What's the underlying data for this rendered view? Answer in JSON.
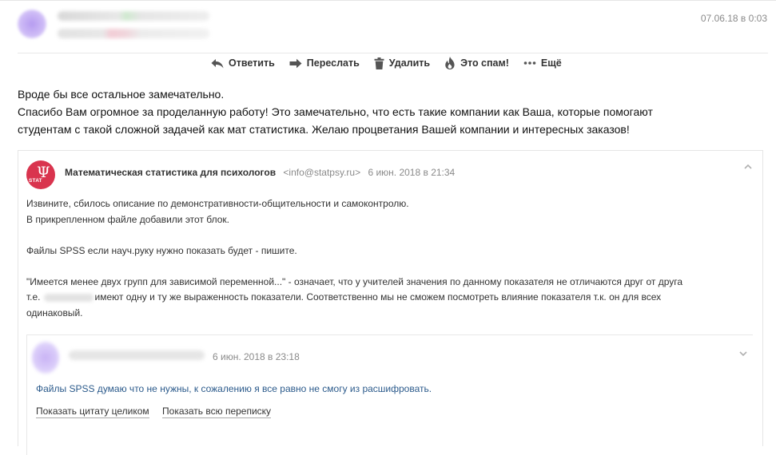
{
  "header": {
    "date": "07.06.18 в 0:03"
  },
  "toolbar": {
    "reply": "Ответить",
    "forward": "Переслать",
    "delete": "Удалить",
    "spam": "Это спам!",
    "more": "Ещё"
  },
  "message": {
    "lines": [
      "Вроде бы все остальное замечательно.",
      "Спасибо Вам огромное за проделанную работу! Это замечательно, что есть такие компании как Ваша, которые помогают",
      "студентам с такой сложной задачей как мат статистика. Желаю процветания Вашей компании и интересных заказов!"
    ]
  },
  "quoted": {
    "avatar_text": "STAT",
    "avatar_symbol": "Ψ",
    "sender": "Математическая статистика для психологов",
    "email": "<info@statpsy.ru>",
    "date": "6 июн. 2018 в 21:34",
    "lines": {
      "l1": "Извините, сбилось описание по демонстративности-общительности и самоконтролю.",
      "l2": "В прикрепленном файле добавили этот блок.",
      "l3": "Файлы SPSS если науч.руку нужно показать будет - пишите.",
      "l4": "\"Имеется менее двух групп для зависимой переменной...\" - означает, что у учителей значения по данному показателя не отличаются друг от друга",
      "l5a": "т.е.",
      "l5b": "имеют одну и ту же выраженность показатели. Соответственно мы не сможем посмотреть влияние показателя т.к. он для всех",
      "l6": "одинаковый."
    },
    "nested": {
      "date": "6 июн. 2018 в 23:18",
      "text": "Файлы SPSS думаю что не нужны, к сожалению я все равно не смогу из расшифровать.",
      "show_quote": "Показать цитату целиком",
      "show_thread": "Показать всю переписку"
    }
  },
  "colors": {
    "accent_red": "#d9344e",
    "link_blue": "#2b5a8b"
  }
}
